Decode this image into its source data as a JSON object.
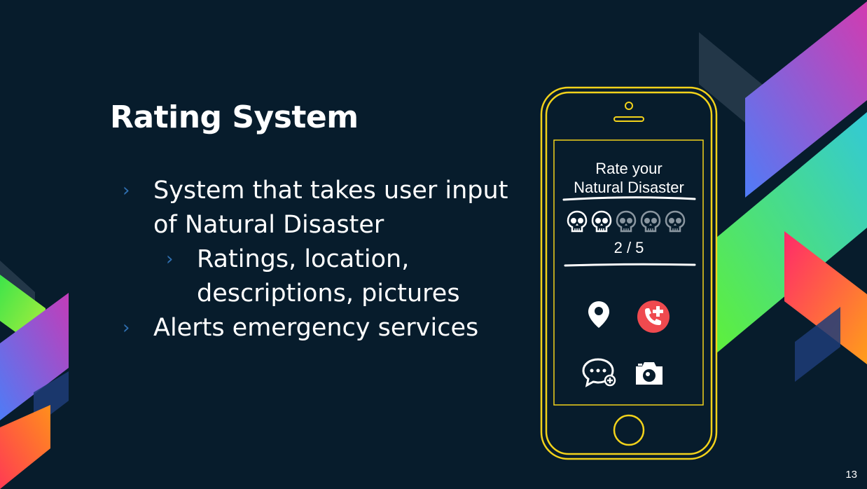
{
  "slide": {
    "title": "Rating System",
    "bullets": [
      {
        "level": 1,
        "text": "System that takes user input of Natural Disaster"
      },
      {
        "level": 2,
        "text": "Ratings, location, descriptions, pictures"
      },
      {
        "level": 1,
        "text": "Alerts emergency services"
      }
    ],
    "bullet_marker": "›",
    "page_number": "13"
  },
  "phone_screen": {
    "prompt_line1": "Rate your",
    "prompt_line2": "Natural Disaster",
    "rating_text": "2 / 5",
    "rating_value": 2,
    "rating_max": 5,
    "icons": [
      "location-pin-icon",
      "emergency-call-icon",
      "add-comment-icon",
      "camera-icon"
    ]
  },
  "colors": {
    "background": "#071c2c",
    "phone_outline": "#f2d21b",
    "bullet_arrow": "#2f6fb0",
    "call_icon": "#ef4a4f"
  }
}
